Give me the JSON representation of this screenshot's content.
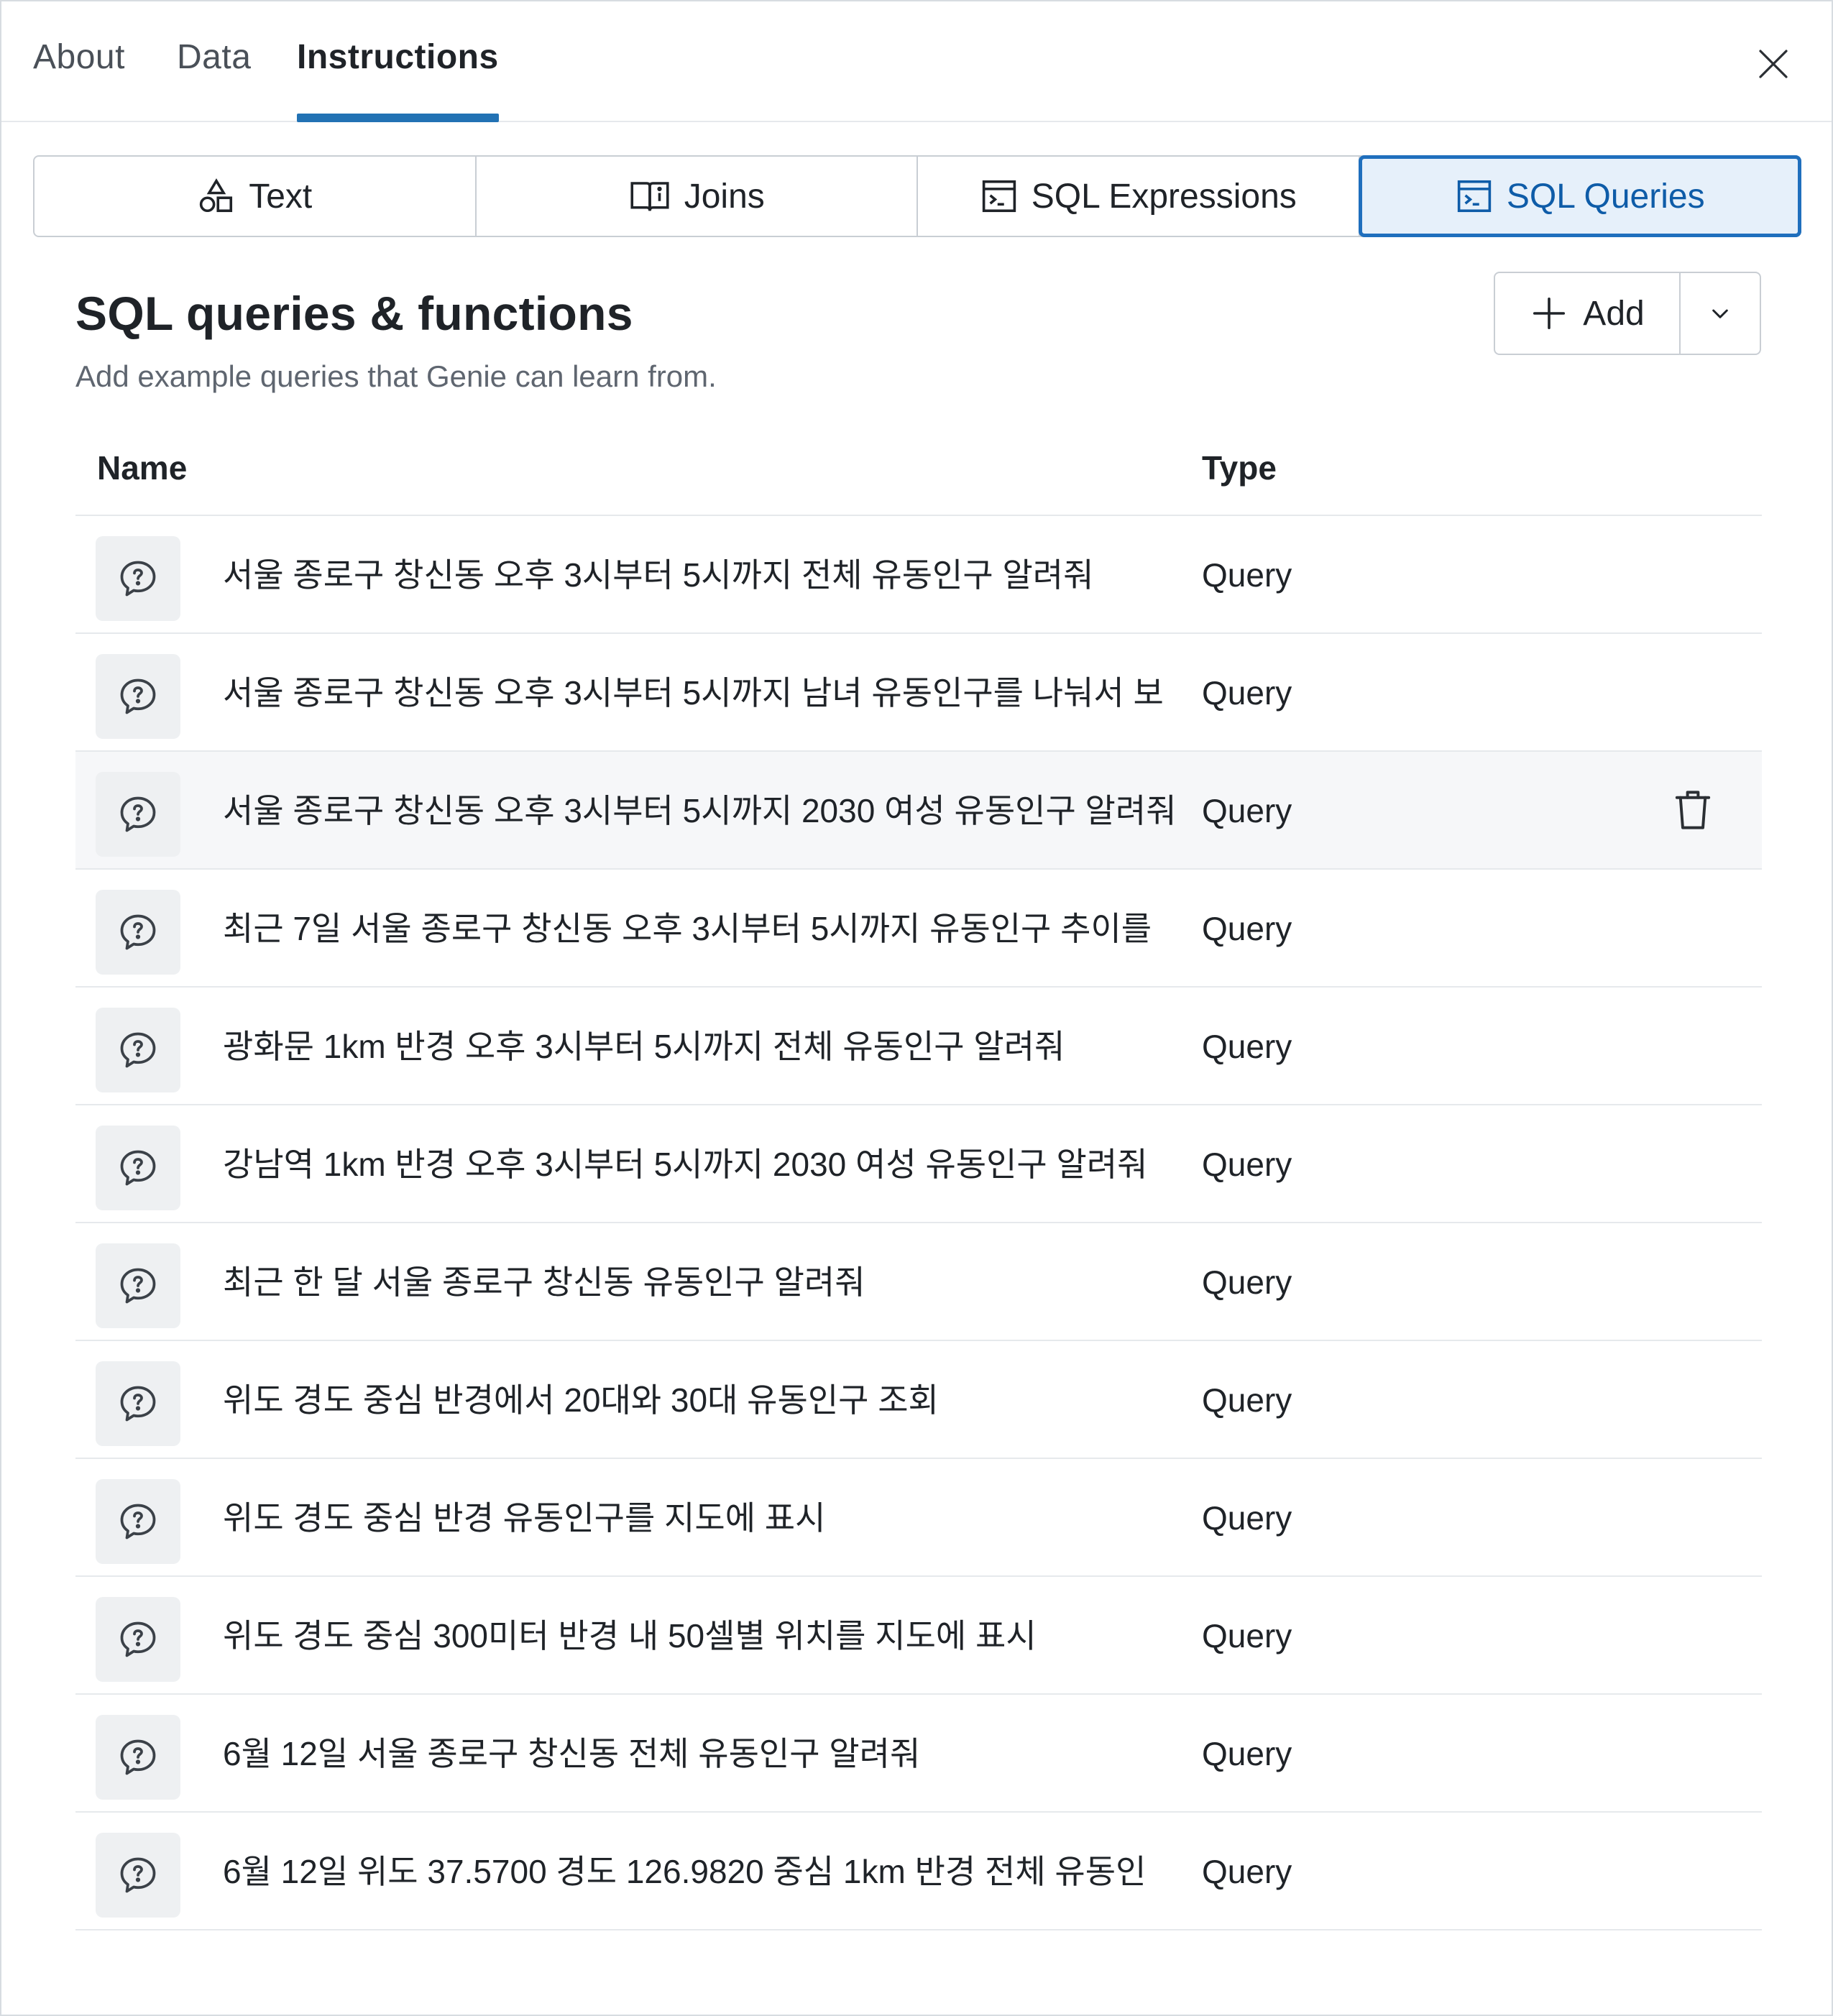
{
  "tabs": [
    {
      "label": "About",
      "active": false
    },
    {
      "label": "Data",
      "active": false
    },
    {
      "label": "Instructions",
      "active": true
    }
  ],
  "segmented": [
    {
      "label": "Text",
      "icon": "shapes-icon",
      "active": false
    },
    {
      "label": "Joins",
      "icon": "book-info-icon",
      "active": false
    },
    {
      "label": "SQL Expressions",
      "icon": "terminal-window-icon",
      "active": false
    },
    {
      "label": "SQL Queries",
      "icon": "terminal-window-icon",
      "active": true
    }
  ],
  "section": {
    "title": "SQL queries & functions",
    "subtitle": "Add example queries that Genie can learn from.",
    "add_label": "Add"
  },
  "table": {
    "headers": {
      "name": "Name",
      "type": "Type"
    },
    "rows": [
      {
        "name": "서울 종로구 창신동 오후 3시부터 5시까지 전체 유동인구 알려줘",
        "type": "Query"
      },
      {
        "name": "서울 종로구 창신동 오후 3시부터 5시까지 남녀 유동인구를 나눠서 보",
        "type": "Query"
      },
      {
        "name": "서울 종로구 창신동 오후 3시부터 5시까지 2030 여성 유동인구 알려줘",
        "type": "Query",
        "hover": true
      },
      {
        "name": "최근 7일 서울 종로구 창신동 오후 3시부터 5시까지 유동인구 추이를",
        "type": "Query"
      },
      {
        "name": "광화문 1km 반경 오후 3시부터 5시까지 전체 유동인구 알려줘",
        "type": "Query"
      },
      {
        "name": "강남역 1km 반경 오후 3시부터 5시까지 2030 여성 유동인구 알려줘",
        "type": "Query"
      },
      {
        "name": "최근 한 달 서울 종로구 창신동 유동인구 알려줘",
        "type": "Query"
      },
      {
        "name": "위도 경도 중심 반경에서 20대와 30대 유동인구 조회",
        "type": "Query"
      },
      {
        "name": "위도 경도 중심 반경 유동인구를 지도에 표시",
        "type": "Query"
      },
      {
        "name": "위도 경도 중심 300미터 반경 내 50셀별 위치를 지도에 표시",
        "type": "Query"
      },
      {
        "name": "6월 12일 서울 종로구 창신동 전체 유동인구 알려줘",
        "type": "Query"
      },
      {
        "name": "6월 12일 위도 37.5700 경도 126.9820 중심 1km 반경 전체 유동인",
        "type": "Query"
      }
    ]
  },
  "colors": {
    "accent": "#2272b4",
    "active_segment_bg": "#e6f0fa",
    "border": "#c9ced4"
  }
}
